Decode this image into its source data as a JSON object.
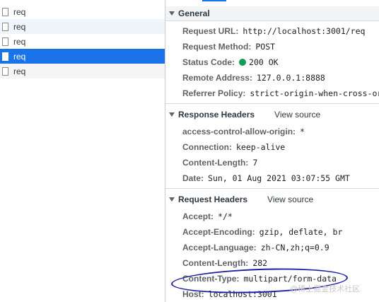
{
  "requests": [
    {
      "name": "req"
    },
    {
      "name": "req"
    },
    {
      "name": "req"
    },
    {
      "name": "req"
    },
    {
      "name": "req"
    }
  ],
  "general": {
    "title": "General",
    "rows": [
      {
        "name": "Request URL:",
        "value": "http://localhost:3001/req"
      },
      {
        "name": "Request Method:",
        "value": "POST"
      },
      {
        "name": "Status Code:",
        "value": "200 OK"
      },
      {
        "name": "Remote Address:",
        "value": "127.0.0.1:8888"
      },
      {
        "name": "Referrer Policy:",
        "value": "strict-origin-when-cross-ori"
      }
    ]
  },
  "response_headers": {
    "title": "Response Headers",
    "view_source": "View source",
    "rows": [
      {
        "name": "access-control-allow-origin:",
        "value": "*"
      },
      {
        "name": "Connection:",
        "value": "keep-alive"
      },
      {
        "name": "Content-Length:",
        "value": "7"
      },
      {
        "name": "Date:",
        "value": "Sun, 01 Aug 2021 03:07:55 GMT"
      }
    ]
  },
  "request_headers": {
    "title": "Request Headers",
    "view_source": "View source",
    "rows": [
      {
        "name": "Accept:",
        "value": "*/*"
      },
      {
        "name": "Accept-Encoding:",
        "value": "gzip, deflate, br"
      },
      {
        "name": "Accept-Language:",
        "value": "zh-CN,zh;q=0.9"
      },
      {
        "name": "Content-Length:",
        "value": "282"
      },
      {
        "name": "Content-Type:",
        "value": "multipart/form-data"
      },
      {
        "name": "Host:",
        "value": "localhost:3001"
      }
    ]
  },
  "watermark": "@稀土掘金技术社区",
  "colors": {
    "selected_row": "#1a73e8",
    "status_ok": "#0d9d58",
    "annotation": "#1f1fa0"
  }
}
